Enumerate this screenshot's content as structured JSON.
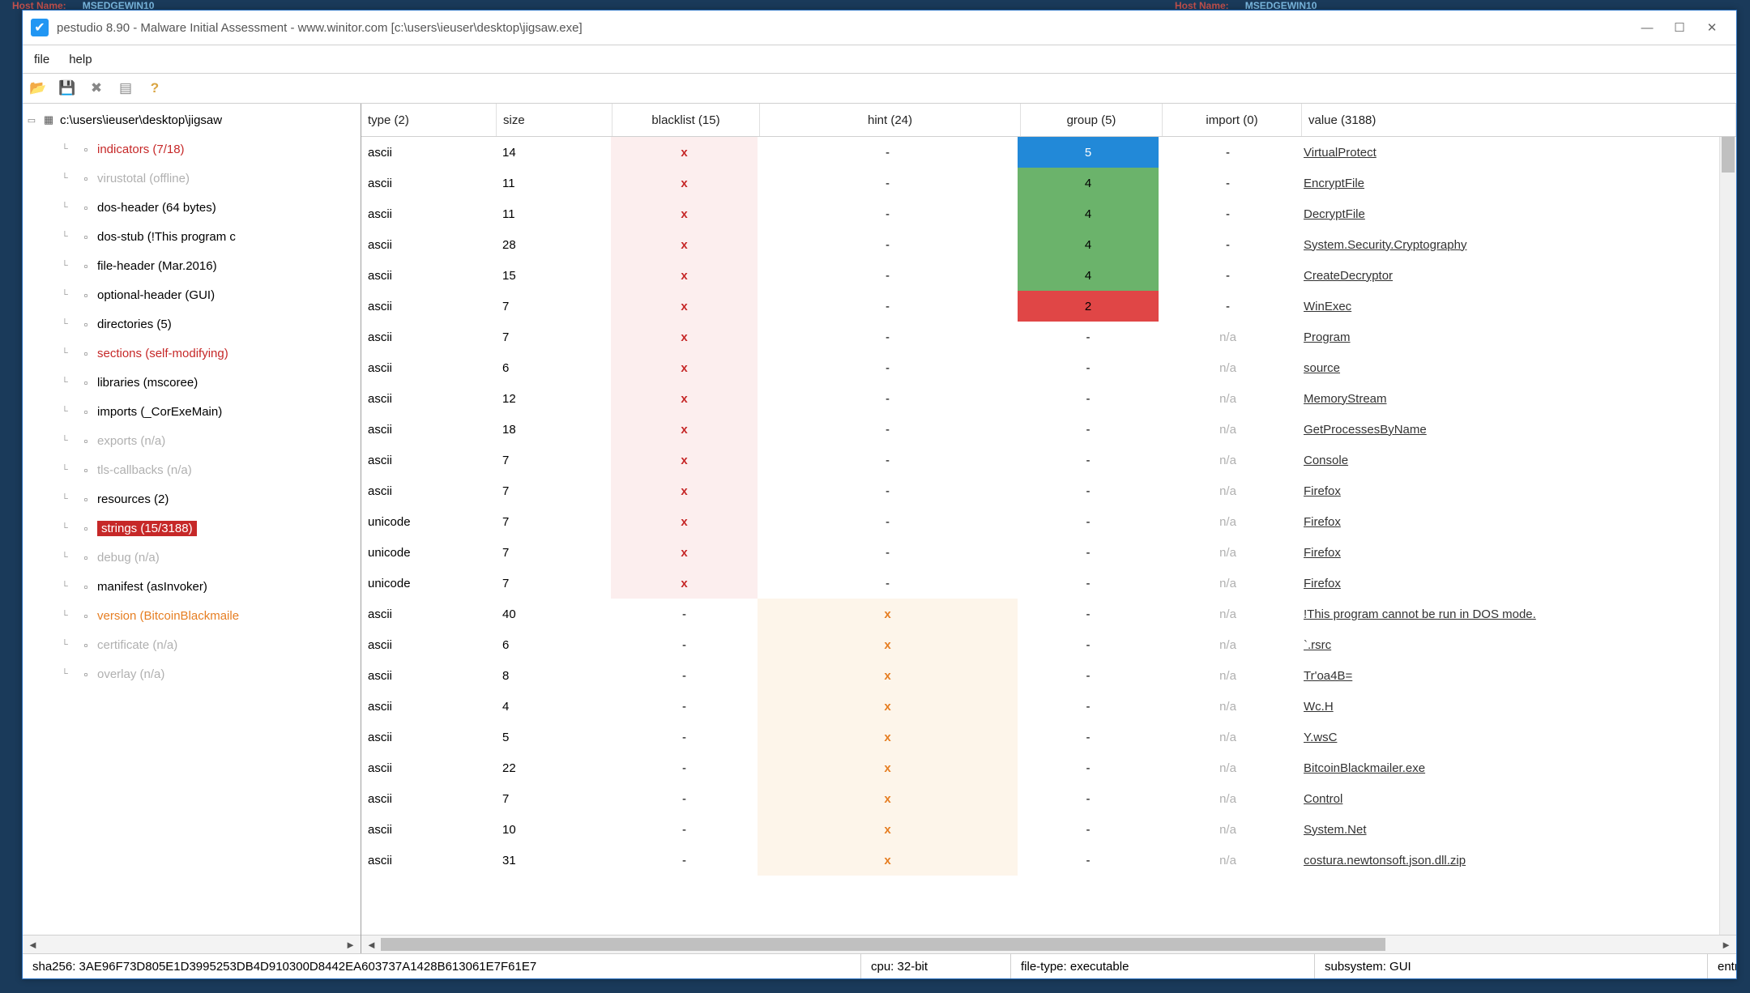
{
  "desktop": {
    "host_label": "Host Name:",
    "host_name": "MSEDGEWIN10"
  },
  "window": {
    "title": "pestudio 8.90 - Malware Initial Assessment - www.winitor.com [c:\\users\\ieuser\\desktop\\jigsaw.exe]",
    "menu": {
      "file": "file",
      "help": "help"
    },
    "controls": {
      "min": "—",
      "max": "☐",
      "close": "✕"
    }
  },
  "tree": {
    "root": "c:\\users\\ieuser\\desktop\\jigsaw",
    "items": [
      {
        "label": "indicators (7/18)",
        "style": "red"
      },
      {
        "label": "virustotal (offline)",
        "style": "gray"
      },
      {
        "label": "dos-header (64 bytes)",
        "style": ""
      },
      {
        "label": "dos-stub (!This program c",
        "style": ""
      },
      {
        "label": "file-header (Mar.2016)",
        "style": ""
      },
      {
        "label": "optional-header (GUI)",
        "style": ""
      },
      {
        "label": "directories (5)",
        "style": ""
      },
      {
        "label": "sections (self-modifying)",
        "style": "red"
      },
      {
        "label": "libraries (mscoree)",
        "style": ""
      },
      {
        "label": "imports (_CorExeMain)",
        "style": ""
      },
      {
        "label": "exports (n/a)",
        "style": "gray"
      },
      {
        "label": "tls-callbacks (n/a)",
        "style": "gray"
      },
      {
        "label": "resources (2)",
        "style": ""
      },
      {
        "label": "strings (15/3188)",
        "style": "selected"
      },
      {
        "label": "debug (n/a)",
        "style": "gray"
      },
      {
        "label": "manifest (asInvoker)",
        "style": ""
      },
      {
        "label": "version (BitcoinBlackmaile",
        "style": "orange"
      },
      {
        "label": "certificate (n/a)",
        "style": "gray"
      },
      {
        "label": "overlay (n/a)",
        "style": "gray"
      }
    ]
  },
  "table": {
    "headers": {
      "type": "type (2)",
      "size": "size",
      "blacklist": "blacklist (15)",
      "hint": "hint (24)",
      "group": "group (5)",
      "import": "import (0)",
      "value": "value (3188)"
    },
    "rows": [
      {
        "type": "ascii",
        "size": "14",
        "bl": "x",
        "hint": "-",
        "grp": "5",
        "grpcls": "grp-blue",
        "imp": "-",
        "impcls": "",
        "val": "VirtualProtect"
      },
      {
        "type": "ascii",
        "size": "11",
        "bl": "x",
        "hint": "-",
        "grp": "4",
        "grpcls": "grp-green",
        "imp": "-",
        "impcls": "",
        "val": "EncryptFile"
      },
      {
        "type": "ascii",
        "size": "11",
        "bl": "x",
        "hint": "-",
        "grp": "4",
        "grpcls": "grp-green",
        "imp": "-",
        "impcls": "",
        "val": "DecryptFile"
      },
      {
        "type": "ascii",
        "size": "28",
        "bl": "x",
        "hint": "-",
        "grp": "4",
        "grpcls": "grp-green",
        "imp": "-",
        "impcls": "",
        "val": "System.Security.Cryptography"
      },
      {
        "type": "ascii",
        "size": "15",
        "bl": "x",
        "hint": "-",
        "grp": "4",
        "grpcls": "grp-green",
        "imp": "-",
        "impcls": "",
        "val": "CreateDecryptor"
      },
      {
        "type": "ascii",
        "size": "7",
        "bl": "x",
        "hint": "-",
        "grp": "2",
        "grpcls": "grp-red",
        "imp": "-",
        "impcls": "",
        "val": "WinExec"
      },
      {
        "type": "ascii",
        "size": "7",
        "bl": "x",
        "hint": "-",
        "grp": "-",
        "grpcls": "",
        "imp": "n/a",
        "impcls": "na",
        "val": "Program"
      },
      {
        "type": "ascii",
        "size": "6",
        "bl": "x",
        "hint": "-",
        "grp": "-",
        "grpcls": "",
        "imp": "n/a",
        "impcls": "na",
        "val": "source"
      },
      {
        "type": "ascii",
        "size": "12",
        "bl": "x",
        "hint": "-",
        "grp": "-",
        "grpcls": "",
        "imp": "n/a",
        "impcls": "na",
        "val": "MemoryStream"
      },
      {
        "type": "ascii",
        "size": "18",
        "bl": "x",
        "hint": "-",
        "grp": "-",
        "grpcls": "",
        "imp": "n/a",
        "impcls": "na",
        "val": "GetProcessesByName"
      },
      {
        "type": "ascii",
        "size": "7",
        "bl": "x",
        "hint": "-",
        "grp": "-",
        "grpcls": "",
        "imp": "n/a",
        "impcls": "na",
        "val": "Console"
      },
      {
        "type": "ascii",
        "size": "7",
        "bl": "x",
        "hint": "-",
        "grp": "-",
        "grpcls": "",
        "imp": "n/a",
        "impcls": "na",
        "val": "Firefox"
      },
      {
        "type": "unicode",
        "size": "7",
        "bl": "x",
        "hint": "-",
        "grp": "-",
        "grpcls": "",
        "imp": "n/a",
        "impcls": "na",
        "val": "Firefox"
      },
      {
        "type": "unicode",
        "size": "7",
        "bl": "x",
        "hint": "-",
        "grp": "-",
        "grpcls": "",
        "imp": "n/a",
        "impcls": "na",
        "val": "Firefox"
      },
      {
        "type": "unicode",
        "size": "7",
        "bl": "x",
        "hint": "-",
        "grp": "-",
        "grpcls": "",
        "imp": "n/a",
        "impcls": "na",
        "val": "Firefox"
      },
      {
        "type": "ascii",
        "size": "40",
        "bl": "-",
        "hint": "x",
        "grp": "-",
        "grpcls": "",
        "imp": "n/a",
        "impcls": "na",
        "val": "!This program cannot be run in DOS mode."
      },
      {
        "type": "ascii",
        "size": "6",
        "bl": "-",
        "hint": "x",
        "grp": "-",
        "grpcls": "",
        "imp": "n/a",
        "impcls": "na",
        "val": "`.rsrc"
      },
      {
        "type": "ascii",
        "size": "8",
        "bl": "-",
        "hint": "x",
        "grp": "-",
        "grpcls": "",
        "imp": "n/a",
        "impcls": "na",
        "val": "Tr'oa4B="
      },
      {
        "type": "ascii",
        "size": "4",
        "bl": "-",
        "hint": "x",
        "grp": "-",
        "grpcls": "",
        "imp": "n/a",
        "impcls": "na",
        "val": "Wc.H"
      },
      {
        "type": "ascii",
        "size": "5",
        "bl": "-",
        "hint": "x",
        "grp": "-",
        "grpcls": "",
        "imp": "n/a",
        "impcls": "na",
        "val": "Y.wsC"
      },
      {
        "type": "ascii",
        "size": "22",
        "bl": "-",
        "hint": "x",
        "grp": "-",
        "grpcls": "",
        "imp": "n/a",
        "impcls": "na",
        "val": "BitcoinBlackmailer.exe"
      },
      {
        "type": "ascii",
        "size": "7",
        "bl": "-",
        "hint": "x",
        "grp": "-",
        "grpcls": "",
        "imp": "n/a",
        "impcls": "na",
        "val": "Control"
      },
      {
        "type": "ascii",
        "size": "10",
        "bl": "-",
        "hint": "x",
        "grp": "-",
        "grpcls": "",
        "imp": "n/a",
        "impcls": "na",
        "val": "System.Net"
      },
      {
        "type": "ascii",
        "size": "31",
        "bl": "-",
        "hint": "x",
        "grp": "-",
        "grpcls": "",
        "imp": "n/a",
        "impcls": "na",
        "val": "costura.newtonsoft.json.dll.zip"
      }
    ]
  },
  "status": {
    "sha": "sha256: 3AE96F73D805E1D3995253DB4D910300D8442EA603737A1428B613061E7F61E7",
    "cpu": "cpu: 32-bit",
    "filetype": "file-type: executable",
    "subsystem": "subsystem: GUI",
    "entry": "entry-poi"
  }
}
